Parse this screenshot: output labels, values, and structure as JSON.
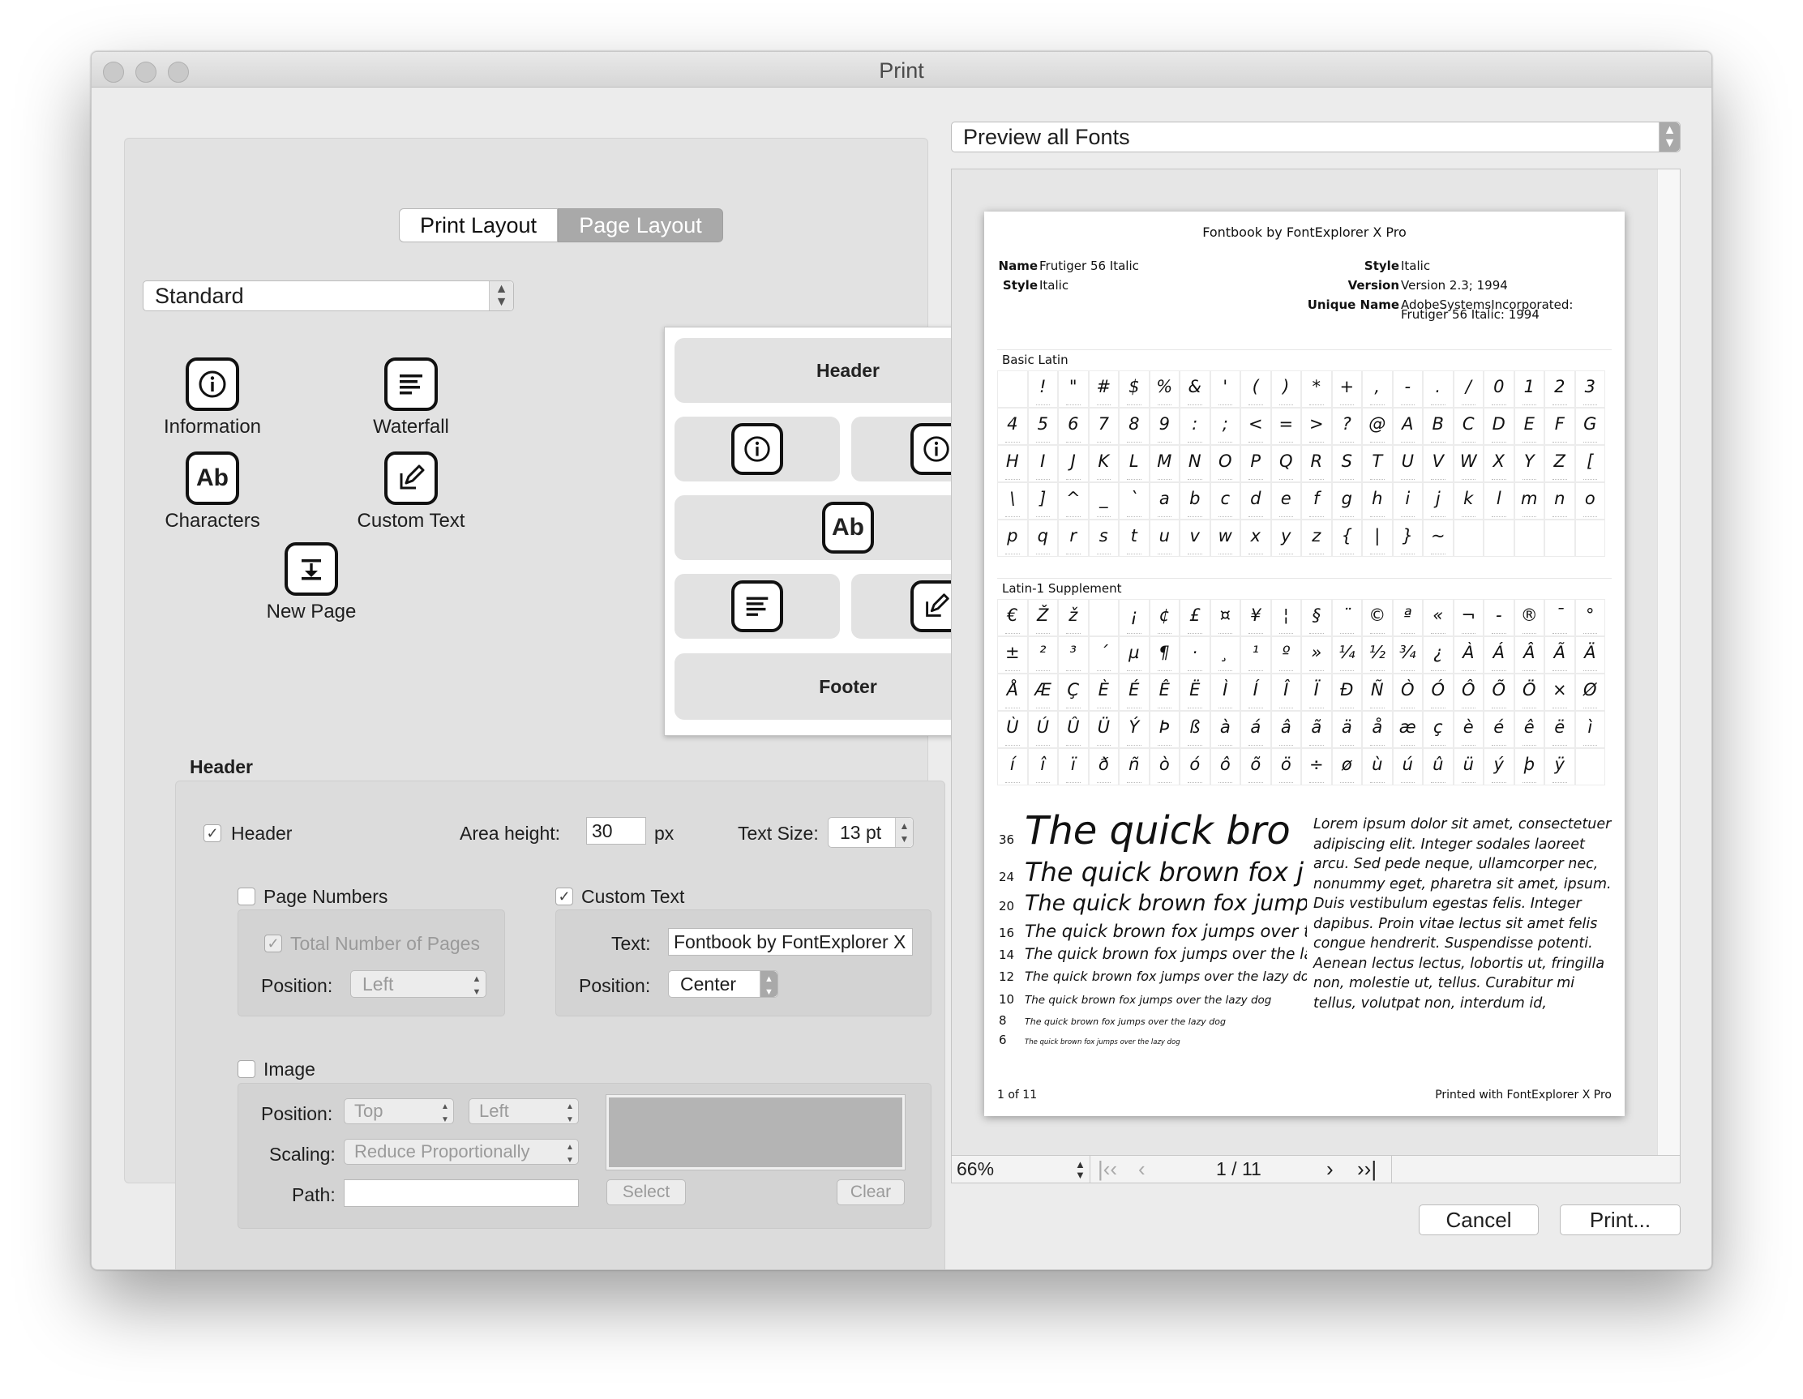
{
  "window": {
    "title": "Print"
  },
  "tabs": [
    "Print Layout",
    "Page Layout"
  ],
  "layout_template": {
    "value": "Standard"
  },
  "tools": {
    "information": "Information",
    "waterfall": "Waterfall",
    "characters": "Characters",
    "custom_text": "Custom Text",
    "new_page": "New Page",
    "characters_glyph": "Ab"
  },
  "layout_preview": {
    "header": "Header",
    "footer": "Footer"
  },
  "header_section": {
    "title": "Header",
    "header_checkbox": {
      "label": "Header",
      "checked": true
    },
    "area_height_label": "Area height:",
    "area_height_value": "30",
    "area_height_unit": "px",
    "text_size_label": "Text Size:",
    "text_size_value": "13 pt",
    "page_numbers": {
      "label": "Page Numbers",
      "checked": false,
      "total_label": "Total Number of Pages",
      "position_label": "Position:",
      "position_value": "Left"
    },
    "custom_text": {
      "label": "Custom Text",
      "checked": true,
      "text_label": "Text:",
      "text_value": "Fontbook by FontExplorer X",
      "position_label": "Position:",
      "position_value": "Center"
    },
    "image": {
      "label": "Image",
      "checked": false,
      "position_label": "Position:",
      "position_v": "Top",
      "position_h": "Left",
      "scaling_label": "Scaling:",
      "scaling_value": "Reduce Proportionally",
      "path_label": "Path:",
      "path_value": "",
      "select_label": "Select",
      "clear_label": "Clear"
    }
  },
  "font_preview": {
    "dropdown": "Preview all Fonts",
    "page": {
      "header_title": "Fontbook by FontExplorer X Pro",
      "meta_left": [
        {
          "k": "Name",
          "v": "Frutiger 56 Italic"
        },
        {
          "k": "Style",
          "v": "Italic"
        }
      ],
      "meta_right": [
        {
          "k": "Style",
          "v": "Italic"
        },
        {
          "k": "Version",
          "v": "Version 2.3; 1994"
        },
        {
          "k": "Unique Name",
          "v": "AdobeSystemsIncorporated:"
        },
        {
          "k": "",
          "v": "Frutiger 56 Italic: 1994"
        }
      ],
      "basic_latin_title": "Basic Latin",
      "basic_latin": [
        " ",
        "!",
        "\"",
        "#",
        "$",
        "%",
        "&",
        "'",
        "(",
        ")",
        "*",
        "+",
        ",",
        "-",
        ".",
        "/",
        "0",
        "1",
        "2",
        "3",
        "4",
        "5",
        "6",
        "7",
        "8",
        "9",
        ":",
        ";",
        "<",
        "=",
        ">",
        "?",
        "@",
        "A",
        "B",
        "C",
        "D",
        "E",
        "F",
        "G",
        "H",
        "I",
        "J",
        "K",
        "L",
        "M",
        "N",
        "O",
        "P",
        "Q",
        "R",
        "S",
        "T",
        "U",
        "V",
        "W",
        "X",
        "Y",
        "Z",
        "[",
        "\\",
        "]",
        "^",
        "_",
        "`",
        "a",
        "b",
        "c",
        "d",
        "e",
        "f",
        "g",
        "h",
        "i",
        "j",
        "k",
        "l",
        "m",
        "n",
        "o",
        "p",
        "q",
        "r",
        "s",
        "t",
        "u",
        "v",
        "w",
        "x",
        "y",
        "z",
        "{",
        "|",
        "}",
        "~",
        " ",
        " ",
        " ",
        " ",
        " "
      ],
      "latin1_title": "Latin-1 Supplement",
      "latin1": [
        "€",
        "Ž",
        "ž",
        " ",
        "¡",
        "¢",
        "£",
        "¤",
        "¥",
        "¦",
        "§",
        "¨",
        "©",
        "ª",
        "«",
        "¬",
        "-",
        "®",
        "¯",
        "°",
        "±",
        "²",
        "³",
        "´",
        "µ",
        "¶",
        "·",
        "¸",
        "¹",
        "º",
        "»",
        "¼",
        "½",
        "¾",
        "¿",
        "À",
        "Á",
        "Â",
        "Ã",
        "Ä",
        "Å",
        "Æ",
        "Ç",
        "È",
        "É",
        "Ê",
        "Ë",
        "Ì",
        "Í",
        "Î",
        "Ï",
        "Ð",
        "Ñ",
        "Ò",
        "Ó",
        "Ô",
        "Õ",
        "Ö",
        "×",
        "Ø",
        "Ù",
        "Ú",
        "Û",
        "Ü",
        "Ý",
        "Þ",
        "ß",
        "à",
        "á",
        "â",
        "ã",
        "ä",
        "å",
        "æ",
        "ç",
        "è",
        "é",
        "ê",
        "ë",
        "ì",
        "í",
        "î",
        "ï",
        "ð",
        "ñ",
        "ò",
        "ó",
        "ô",
        "õ",
        "ö",
        "÷",
        "ø",
        "ù",
        "ú",
        "û",
        "ü",
        "ý",
        "þ",
        "ÿ",
        " "
      ],
      "waterfall": [
        {
          "size": "36",
          "text": "The quick bro"
        },
        {
          "size": "24",
          "text": "The quick brown fox j"
        },
        {
          "size": "20",
          "text": "The quick brown fox jump"
        },
        {
          "size": "16",
          "text": "The quick brown fox jumps over t"
        },
        {
          "size": "14",
          "text": "The quick brown fox jumps over the la"
        },
        {
          "size": "12",
          "text": "The quick brown fox jumps over the lazy do"
        },
        {
          "size": "10",
          "text": "The quick brown fox jumps over the lazy dog"
        },
        {
          "size": "8",
          "text": "The quick brown fox jumps over the lazy dog"
        },
        {
          "size": "6",
          "text": "The quick brown fox jumps over the lazy dog"
        }
      ],
      "lorem": "Lorem ipsum dolor sit amet, consectetuer adipiscing elit. Integer sodales laoreet arcu. Sed pede neque, ullamcorper nec, nonummy eget, pharetra sit amet, ipsum. Duis vestibulum egestas felis. Integer dapibus. Proin vitae lectus sit amet felis congue hendrerit. Suspendisse potenti. Aenean lectus lectus, lobortis ut, fringilla non, molestie ut, tellus. Curabitur mi tellus, volutpat non, interdum id,",
      "footer_left": "1 of 11",
      "footer_right": "Printed with FontExplorer X Pro"
    },
    "zoom": "66%",
    "page_indicator": "1 / 11"
  },
  "buttons": {
    "cancel": "Cancel",
    "print": "Print..."
  }
}
